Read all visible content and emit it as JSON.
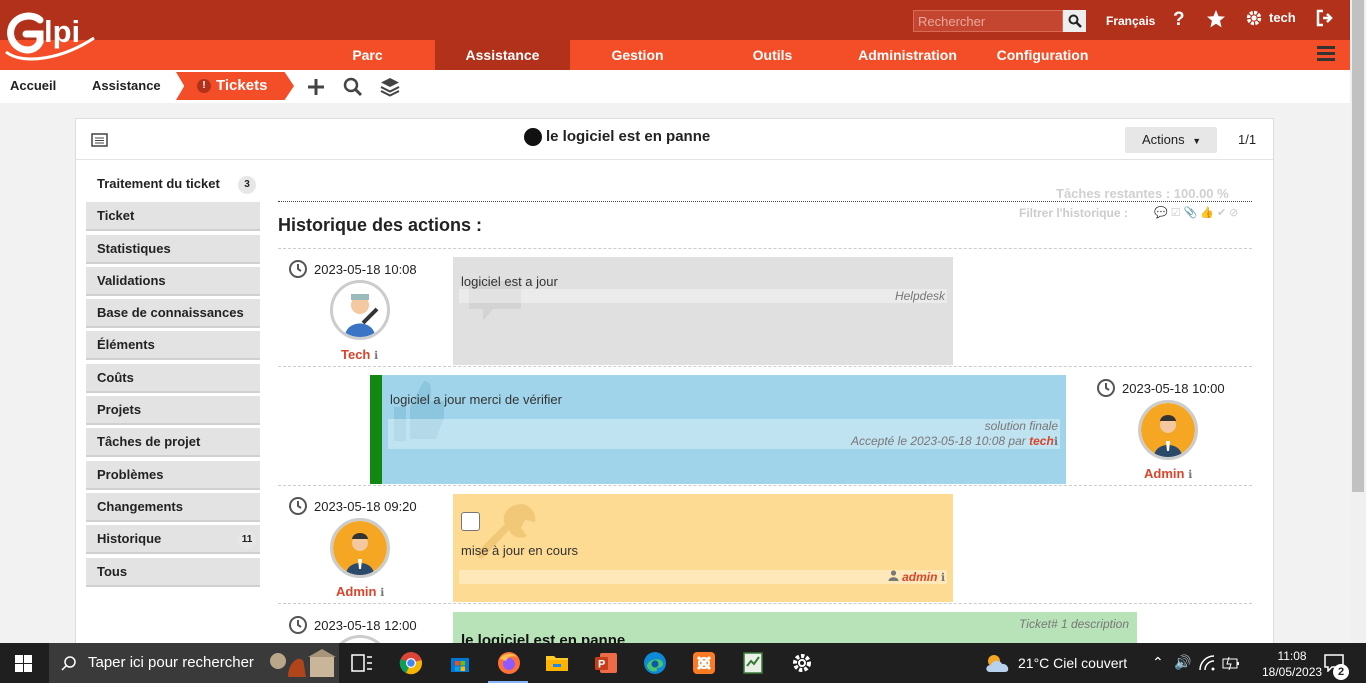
{
  "header": {
    "logo_text": "Glpi",
    "search_placeholder": "Rechercher",
    "language": "Français",
    "user": "tech"
  },
  "nav": {
    "items": [
      {
        "label": "Parc"
      },
      {
        "label": "Assistance",
        "active": true
      },
      {
        "label": "Gestion"
      },
      {
        "label": "Outils"
      },
      {
        "label": "Administration"
      },
      {
        "label": "Configuration"
      }
    ]
  },
  "breadcrumb": {
    "home": "Accueil",
    "section": "Assistance",
    "current": "Tickets"
  },
  "card": {
    "title": "le logiciel est en panne",
    "actions_label": "Actions",
    "pager": "1/1"
  },
  "tabs": [
    {
      "label": "Traitement du ticket",
      "count": "3",
      "active": true
    },
    {
      "label": "Ticket"
    },
    {
      "label": "Statistiques"
    },
    {
      "label": "Validations"
    },
    {
      "label": "Base de connaissances"
    },
    {
      "label": "Éléments"
    },
    {
      "label": "Coûts"
    },
    {
      "label": "Projets"
    },
    {
      "label": "Tâches de projet"
    },
    {
      "label": "Problèmes"
    },
    {
      "label": "Changements"
    },
    {
      "label": "Historique",
      "count": "11"
    },
    {
      "label": "Tous"
    }
  ],
  "timeline": {
    "remaining": "Tâches restantes : 100.00 %",
    "filter_label": "Filtrer l'historique :",
    "title": "Historique des actions :",
    "entries": [
      {
        "date": "2023-05-18 10:08",
        "user": "Tech",
        "content": "logiciel est a jour",
        "meta": "Helpdesk",
        "kind": "followup",
        "color": "#e0e0e0"
      },
      {
        "date": "2023-05-18 10:00",
        "user": "Admin",
        "content": "logiciel a jour merci de vérifier",
        "meta": "solution finale",
        "meta2_prefix": "Accepté le 2023-05-18 10:08 par",
        "meta2_user": "tech",
        "kind": "solution",
        "color": "#9fd4ea"
      },
      {
        "date": "2023-05-18 09:20",
        "user": "Admin",
        "content": "mise à jour en cours",
        "meta_user": "admin",
        "kind": "task",
        "color": "#fddb92"
      },
      {
        "date": "2023-05-18 12:00",
        "content": "le logiciel est en panne",
        "meta": "Ticket# 1 description",
        "kind": "description",
        "color": "#b8e3b8"
      }
    ]
  },
  "taskbar": {
    "search_placeholder": "Taper ici pour rechercher",
    "weather": "21°C  Ciel couvert",
    "time": "11:08",
    "date": "18/05/2023",
    "notifications": "2"
  }
}
